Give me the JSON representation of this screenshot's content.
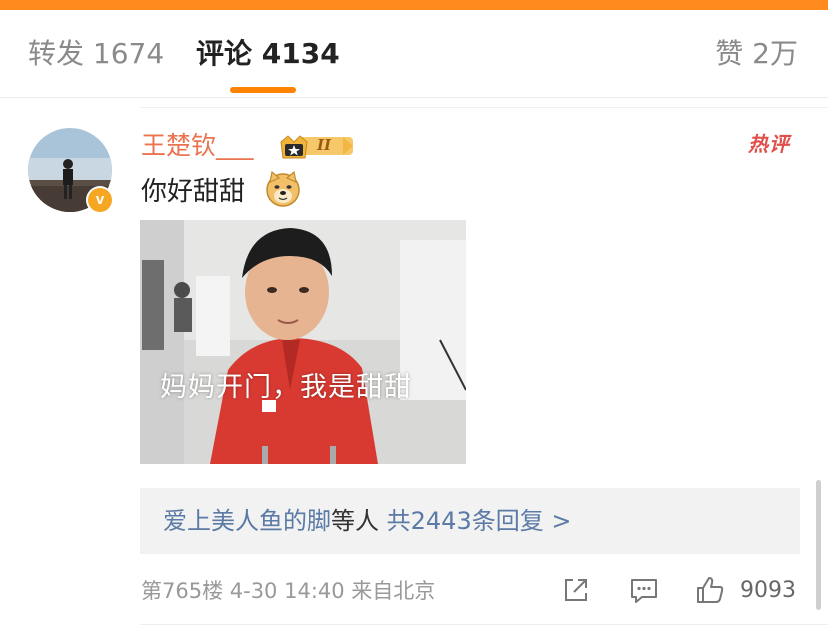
{
  "tabs": {
    "repost": "转发 1674",
    "comments": "评论 4134",
    "likes": "赞 2万"
  },
  "colors": {
    "accent": "#ff8200",
    "username": "#eb7350",
    "link_blue": "#5b7aa6"
  },
  "comment": {
    "username": "王楚钦___",
    "badge_level": "II",
    "badge_icon": "crown-icon",
    "hot_tag": "热评",
    "text": "你好甜甜",
    "emoji": "doge-icon",
    "verified_mark": "v",
    "image_caption": "妈妈开门，我是甜甜",
    "replies": {
      "users": "爱上美人鱼的脚",
      "suffix": "等人",
      "count_text": "共2443条回复 >"
    },
    "meta": "第765楼 4-30 14:40 来自北京",
    "like_count": "9093",
    "actions": [
      "share-icon",
      "reply-icon",
      "like-icon"
    ]
  }
}
